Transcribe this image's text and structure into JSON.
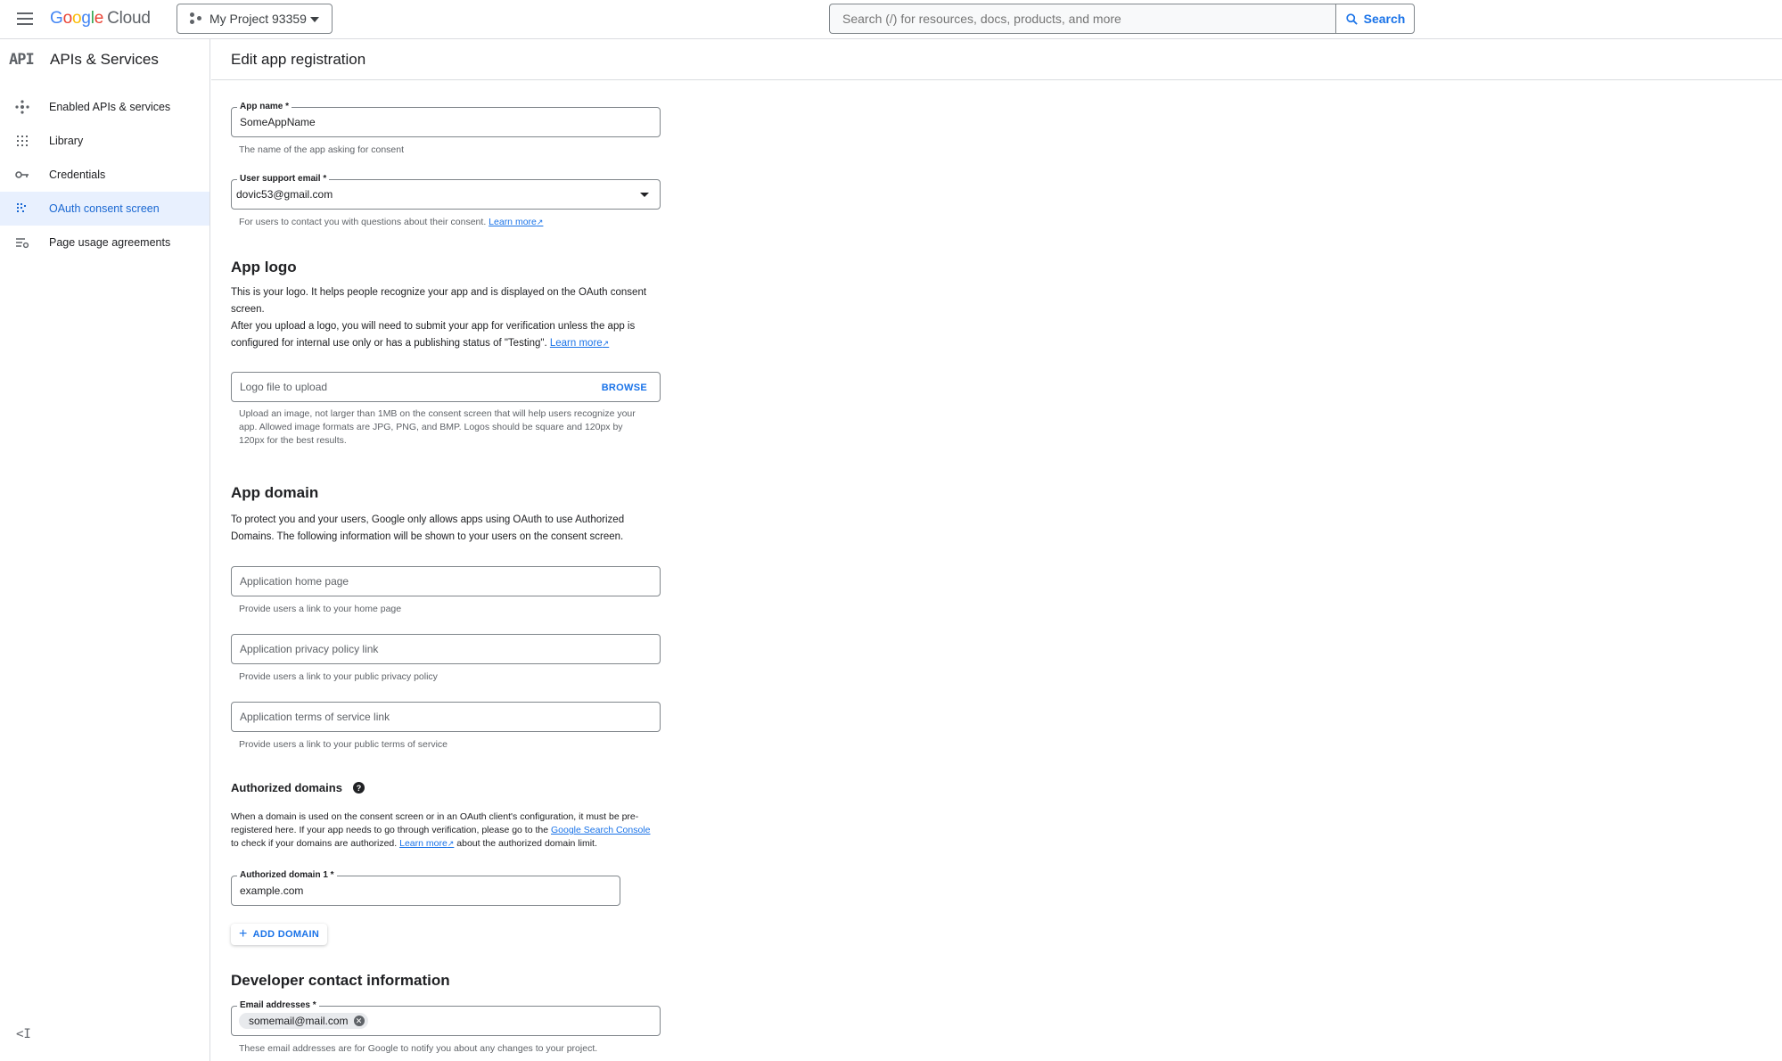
{
  "topbar": {
    "logo_letters": [
      "G",
      "o",
      "o",
      "g",
      "l",
      "e"
    ],
    "logo_product": "Cloud",
    "project_name": "My Project 93359",
    "search_placeholder": "Search (/) for resources, docs, products, and more",
    "search_button": "Search"
  },
  "sidebar": {
    "badge": "API",
    "title": "APIs & Services",
    "items": [
      {
        "label": "Enabled APIs & services",
        "icon": "hub-icon"
      },
      {
        "label": "Library",
        "icon": "library-icon"
      },
      {
        "label": "Credentials",
        "icon": "key-icon"
      },
      {
        "label": "OAuth consent screen",
        "icon": "consent-icon",
        "active": true
      },
      {
        "label": "Page usage agreements",
        "icon": "agreements-icon"
      }
    ],
    "collapse_label": "<I"
  },
  "page": {
    "title": "Edit app registration"
  },
  "form": {
    "app_name": {
      "label": "App name *",
      "value": "SomeAppName",
      "hint": "The name of the app asking for consent"
    },
    "support_email": {
      "label": "User support email *",
      "value": "dovic53@gmail.com",
      "hint": "For users to contact you with questions about their consent.",
      "learn_more": "Learn more"
    },
    "app_logo": {
      "heading": "App logo",
      "desc1": "This is your logo. It helps people recognize your app and is displayed on the OAuth consent screen.",
      "desc2": "After you upload a logo, you will need to submit your app for verification unless the app is configured for internal use only or has a publishing status of \"Testing\".",
      "learn_more": "Learn more",
      "upload_placeholder": "Logo file to upload",
      "browse": "BROWSE",
      "hint": "Upload an image, not larger than 1MB on the consent screen that will help users recognize your app. Allowed image formats are JPG, PNG, and BMP. Logos should be square and 120px by 120px for the best results."
    },
    "app_domain": {
      "heading": "App domain",
      "desc": "To protect you and your users, Google only allows apps using OAuth to use Authorized Domains. The following information will be shown to your users on the consent screen.",
      "home_placeholder": "Application home page",
      "home_hint": "Provide users a link to your home page",
      "privacy_placeholder": "Application privacy policy link",
      "privacy_hint": "Provide users a link to your public privacy policy",
      "tos_placeholder": "Application terms of service link",
      "tos_hint": "Provide users a link to your public terms of service"
    },
    "authorized_domains": {
      "heading": "Authorized domains",
      "desc_a": "When a domain is used on the consent screen or in an OAuth client's configuration, it must be pre-registered here. If your app needs to go through verification, please go to the",
      "link_console": "Google Search Console",
      "desc_b": "to check if your domains are authorized.",
      "learn_more": "Learn more",
      "desc_c": "about the authorized domain limit.",
      "domain1_label": "Authorized domain 1 *",
      "domain1_value": "example.com",
      "add_button": "ADD DOMAIN"
    },
    "developer_contact": {
      "heading": "Developer contact information",
      "label": "Email addresses *",
      "chip": "somemail@mail.com",
      "hint": "These email addresses are for Google to notify you about any changes to your project."
    }
  }
}
